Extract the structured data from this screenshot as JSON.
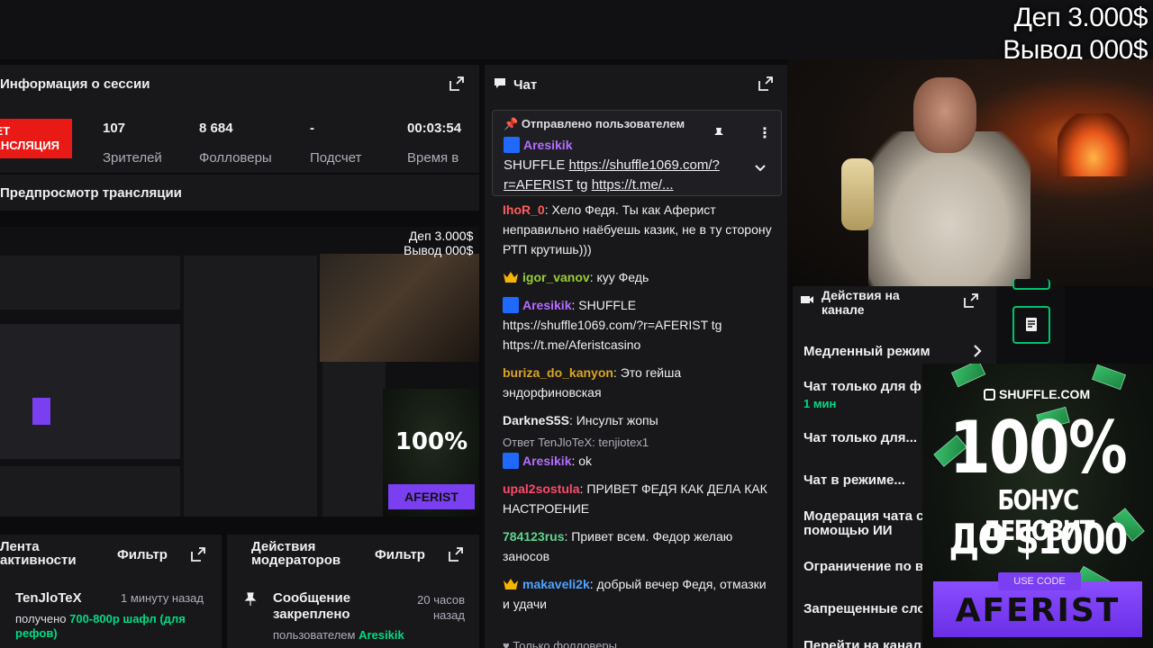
{
  "overlay": {
    "deposit": "Деп 3.000$",
    "withdraw": "Вывод 000$"
  },
  "session": {
    "title": "Информация о сессии",
    "live_badge": "ИДЕТ ТРАНСЛЯЦИЯ",
    "stats": [
      {
        "value": "107",
        "label": "Зрителей"
      },
      {
        "value": "8 684",
        "label": "Фолловеры"
      },
      {
        "value": "-",
        "label": "Подсчет"
      },
      {
        "value": "00:03:54",
        "label": "Время в"
      }
    ]
  },
  "preview": {
    "title": "Предпросмотр трансляции"
  },
  "activity": {
    "title_line1": "Лента",
    "title_line2": "активности",
    "filter": "Фильтр",
    "user": "TenJloTeX",
    "time": "1 минуту назад",
    "text_prefix": "получено",
    "text_highlight": "700-800р шафл (для рефов)"
  },
  "mod_actions": {
    "title_line1": "Действия",
    "title_line2": "модераторов",
    "filter": "Фильтр",
    "event_line1": "Сообщение",
    "event_line2": "закреплено",
    "time_line1": "20 часов",
    "time_line2": "назад",
    "by_prefix": "пользователем",
    "by_user": "Aresikik"
  },
  "chat": {
    "title": "Чат",
    "pinned_header": "Отправлено пользователем",
    "pinned_user": "Aresikik",
    "pinned_text1": "SHUFFLE ",
    "pinned_link1": "https://shuffle1069.com/?r=AFERIST",
    "pinned_text2": " tg ",
    "pinned_link2": "https://t.me/...",
    "messages": [
      {
        "user": "IhoR_0",
        "color": "#ff5c5c",
        "text": "Хело Федя. Ты как Аферист неправильно наёбуешь казик, не в ту сторону РТП крутишь)))"
      },
      {
        "user": "igor_vanov",
        "color": "#9acd32",
        "text": "куу Федь",
        "badge": "crown"
      },
      {
        "user": "Aresikik",
        "color": "#b56cff",
        "text": "SHUFFLE https://shuffle1069.com/?r=AFERIST tg https://t.me/Aferistcasino",
        "badge": "vip"
      },
      {
        "user": "buriza_do_kanyon",
        "color": "#daa520",
        "text": "Это гейша эндорфиновская"
      },
      {
        "user": "DarkneS5S",
        "color": "#efeff1",
        "text": "Инсульт жопы"
      },
      {
        "user": "Aresikik",
        "color": "#b56cff",
        "text": "ok",
        "badge": "vip",
        "reply": "Ответ TenJloTeX: tenjiotex1"
      },
      {
        "user": "upal2sostula",
        "color": "#ff4a6a",
        "text": "ПРИВЕТ ФЕДЯ КАК ДЕЛА КАК НАСТРОЕНИЕ"
      },
      {
        "user": "784123rus",
        "color": "#5fd38d",
        "text": "Привет всем. Федор желаю заносов"
      },
      {
        "user": "makaveli2k",
        "color": "#4fa3ff",
        "text": "добрый вечер Федя, отмазки и удачи",
        "badge": "crown"
      }
    ],
    "footer": "Только фолловеры"
  },
  "channel_actions": {
    "title_line1": "Действия на",
    "title_line2": "канале",
    "items": [
      "Медленный режим",
      "Чат только для ф",
      "Чат только для...",
      "Чат в режиме...",
      "Модерация чата с",
      "Ограничение по в",
      "Запрещенные сло",
      "Перейти на канал"
    ],
    "followers_sub": "1 мин",
    "ai_line2": "помощью ИИ"
  },
  "ad": {
    "brand": "SHUFFLE.COM",
    "big": "100%",
    "line2": "БОНУС ДЕПОЗИТ",
    "line3": "ДО $1000",
    "code_label": "USE CODE",
    "code": "AFERIST"
  },
  "colors": {
    "live": "#e91916",
    "accent": "#00db84",
    "panel": "#18181b",
    "ad_purple": "#7b3ff2"
  }
}
